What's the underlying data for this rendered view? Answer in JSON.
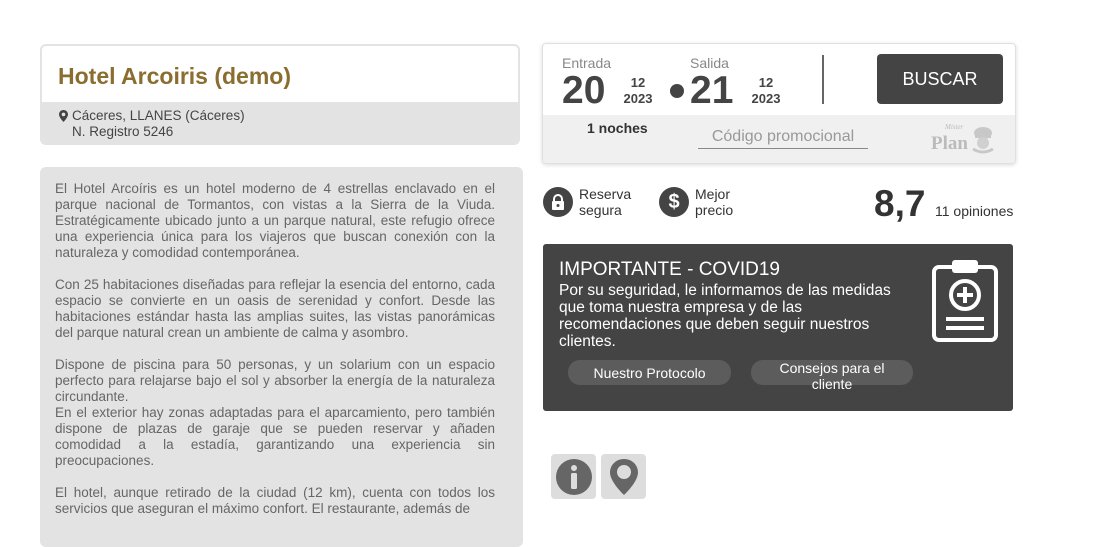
{
  "hotel": {
    "name": "Hotel Arcoiris (demo)",
    "location": "Cáceres, LLANES (Cáceres)",
    "registry": "N. Registro 5246",
    "pin_icon": "map-pin-icon"
  },
  "description": {
    "paragraphs": [
      "El Hotel Arcoíris es un hotel moderno de 4 estrellas enclavado en el parque nacional de Tormantos, con vistas a la Sierra de la Viuda. Estratégicamente ubicado junto a un parque natural, este refugio ofrece una experiencia única para los viajeros que buscan conexión con la naturaleza y comodidad contemporánea.",
      "Con 25 habitaciones diseñadas para reflejar la esencia del entorno, cada espacio se convierte en un oasis de serenidad y confort. Desde las habitaciones estándar hasta las amplias suites, las vistas panorámicas del parque natural crean un ambiente de calma y asombro.",
      "Dispone de piscina para 50 personas, y un solarium con un espacio perfecto para relajarse bajo el sol y absorber la energía de la naturaleza circundante.\nEn el exterior hay zonas adaptadas para el aparcamiento, pero también dispone de plazas de garaje que se pueden reservar y añaden comodidad a la estadía, garantizando una experiencia sin preocupaciones.",
      "El hotel, aunque retirado de la ciudad (12 km), cuenta con todos los servicios que aseguran el máximo confort. El restaurante, además de"
    ]
  },
  "booking": {
    "checkin_label": "Entrada",
    "checkin_day": "20",
    "checkin_month": "12",
    "checkin_year": "2023",
    "checkout_label": "Salida",
    "checkout_day": "21",
    "checkout_month": "12",
    "checkout_year": "2023",
    "search_label": "BUSCAR",
    "nights": "1 noches",
    "promo_placeholder": "Código promocional",
    "logo_text_top": "Mister",
    "logo_text": "Plan"
  },
  "badges": {
    "secure_line1": "Reserva",
    "secure_line2": "segura",
    "secure_icon": "lock-icon",
    "price_line1": "Mejor",
    "price_line2": "precio",
    "price_icon": "dollar-icon"
  },
  "rating": {
    "score": "8,7",
    "opinions": "11 opiniones"
  },
  "covid": {
    "title": "IMPORTANTE - COVID19",
    "text": "Por su seguridad, le informamos de las medidas que toma nuestra empresa y de las recomendaciones que deben seguir nuestros clientes.",
    "protocol_button": "Nuestro Protocolo",
    "advice_button": "Consejos para el cliente",
    "icon": "medical-clipboard-icon"
  },
  "icons": {
    "info": "info-icon",
    "location": "location-pin-icon"
  },
  "colors": {
    "title_gold": "#8a6d2f",
    "dark_panel": "#444444",
    "light_gray": "#e3e3e3"
  }
}
